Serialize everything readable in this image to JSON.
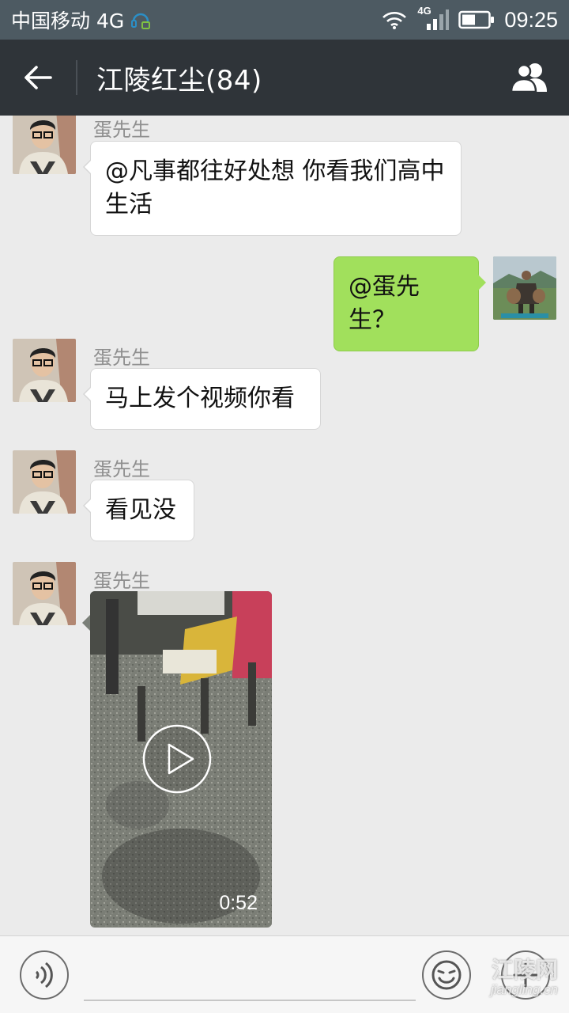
{
  "status_bar": {
    "carrier": "中国移动 4G",
    "network_badge": "4G",
    "time": "09:25",
    "icons": [
      "headset-icon",
      "wifi-icon",
      "signal-icon",
      "battery-icon"
    ]
  },
  "header": {
    "title": "江陵红尘(84)",
    "back_icon": "arrow-left-icon",
    "group_icon": "group-members-icon"
  },
  "messages": [
    {
      "side": "left",
      "sender": "蛋先生",
      "type": "text",
      "text": "@凡事都往好处想 你看我们高中生活"
    },
    {
      "side": "right",
      "type": "text",
      "text": "@蛋先生？"
    },
    {
      "side": "left",
      "sender": "蛋先生",
      "type": "text",
      "text": "马上发个视频你看"
    },
    {
      "side": "left",
      "sender": "蛋先生",
      "type": "text",
      "text": "看见没"
    },
    {
      "side": "left",
      "sender": "蛋先生",
      "type": "video",
      "duration": "0:52"
    }
  ],
  "input_bar": {
    "voice_icon": "voice-icon",
    "emoji_icon": "emoji-icon",
    "plus_icon": "plus-icon"
  },
  "watermark": {
    "cn": "江陵网",
    "en": "jiangling.cn"
  },
  "colors": {
    "title_bar": "#2f3439",
    "status_bar": "#4d5a62",
    "chat_background": "#ebebeb",
    "outgoing_bubble": "#a1e05c",
    "incoming_bubble": "#ffffff"
  }
}
